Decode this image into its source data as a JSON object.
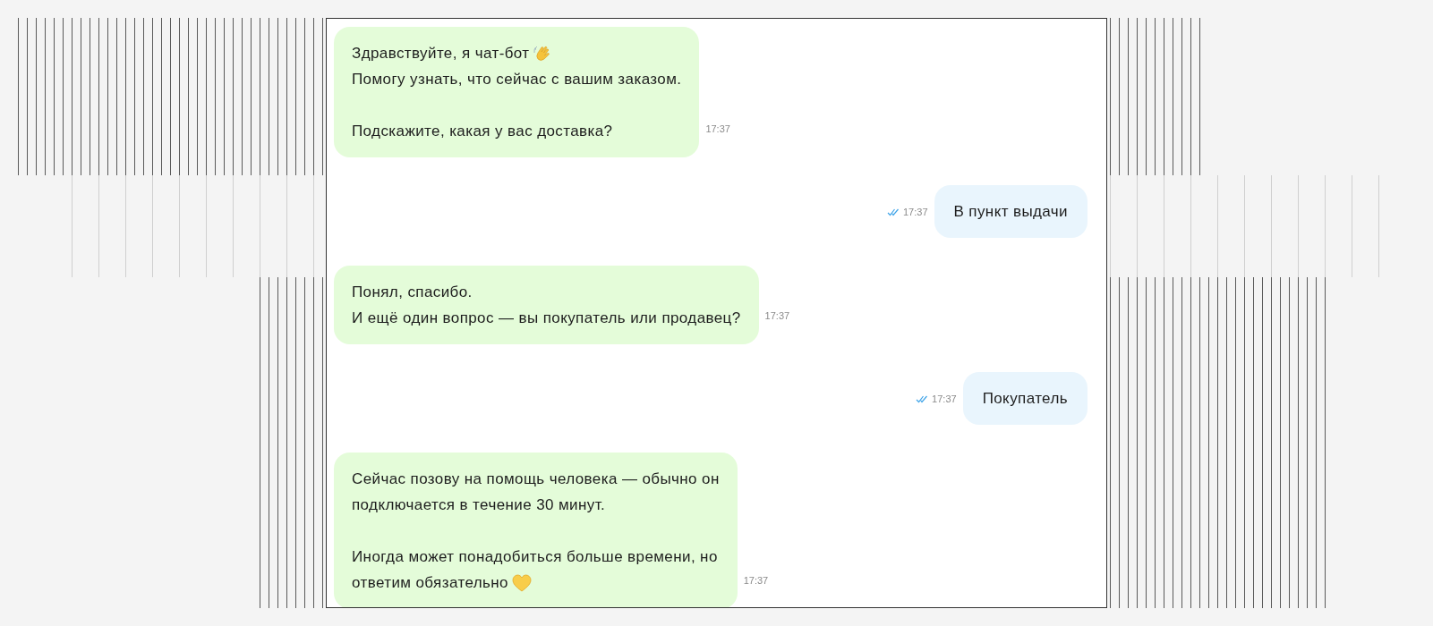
{
  "messages": [
    {
      "kind": "incoming",
      "paragraphs": [
        {
          "lines": [
            {
              "text": "Здравствуйте, я чат-бот",
              "kind": "wave"
            },
            {
              "text": "Помогу узнать, что сейчас с вашим заказом."
            }
          ]
        },
        {
          "lines": [
            {
              "text": "Подскажите, какая у вас доставка?"
            }
          ]
        }
      ],
      "time": "17:37"
    },
    {
      "kind": "outgoing",
      "paragraphs": [
        {
          "lines": [
            {
              "text": "В пункт выдачи"
            }
          ]
        }
      ],
      "time": "17:37",
      "read": true
    },
    {
      "kind": "incoming",
      "paragraphs": [
        {
          "lines": [
            {
              "text": "Понял, спасибо."
            },
            {
              "text": "И ещё один вопрос — вы покупатель или продавец?"
            }
          ]
        }
      ],
      "time": "17:37"
    },
    {
      "kind": "outgoing",
      "paragraphs": [
        {
          "lines": [
            {
              "text": "Покупатель"
            }
          ]
        }
      ],
      "time": "17:37",
      "read": true
    },
    {
      "kind": "incoming",
      "paragraphs": [
        {
          "lines": [
            {
              "text": "Сейчас позову на помощь человека — обычно он"
            },
            {
              "text": "подключается в течение 30 минут."
            }
          ]
        },
        {
          "lines": [
            {
              "text": "Иногда может понадобиться больше времени, но"
            },
            {
              "text": "ответим обязательно",
              "kind": "heart"
            }
          ]
        }
      ],
      "time": "17:37"
    }
  ]
}
